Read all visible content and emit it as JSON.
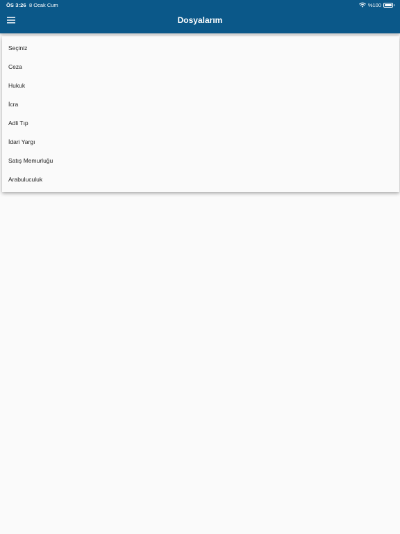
{
  "status_bar": {
    "time": "ÖS 3:26",
    "date": "8 Ocak Cum",
    "battery": "%100",
    "battery_level": 1.0,
    "wifi_icon": "wifi-icon",
    "battery_icon": "battery-icon"
  },
  "header": {
    "title": "Dosyalarım",
    "menu_icon": "hamburger-menu-icon",
    "background_color": "#0b5889"
  },
  "dropdown": {
    "items": [
      {
        "label": "Seçiniz"
      },
      {
        "label": "Ceza"
      },
      {
        "label": "Hukuk"
      },
      {
        "label": "İcra"
      },
      {
        "label": "Adli Tıp"
      },
      {
        "label": "İdari Yargı"
      },
      {
        "label": "Satış Memurluğu"
      },
      {
        "label": "Arabuluculuk"
      }
    ]
  }
}
